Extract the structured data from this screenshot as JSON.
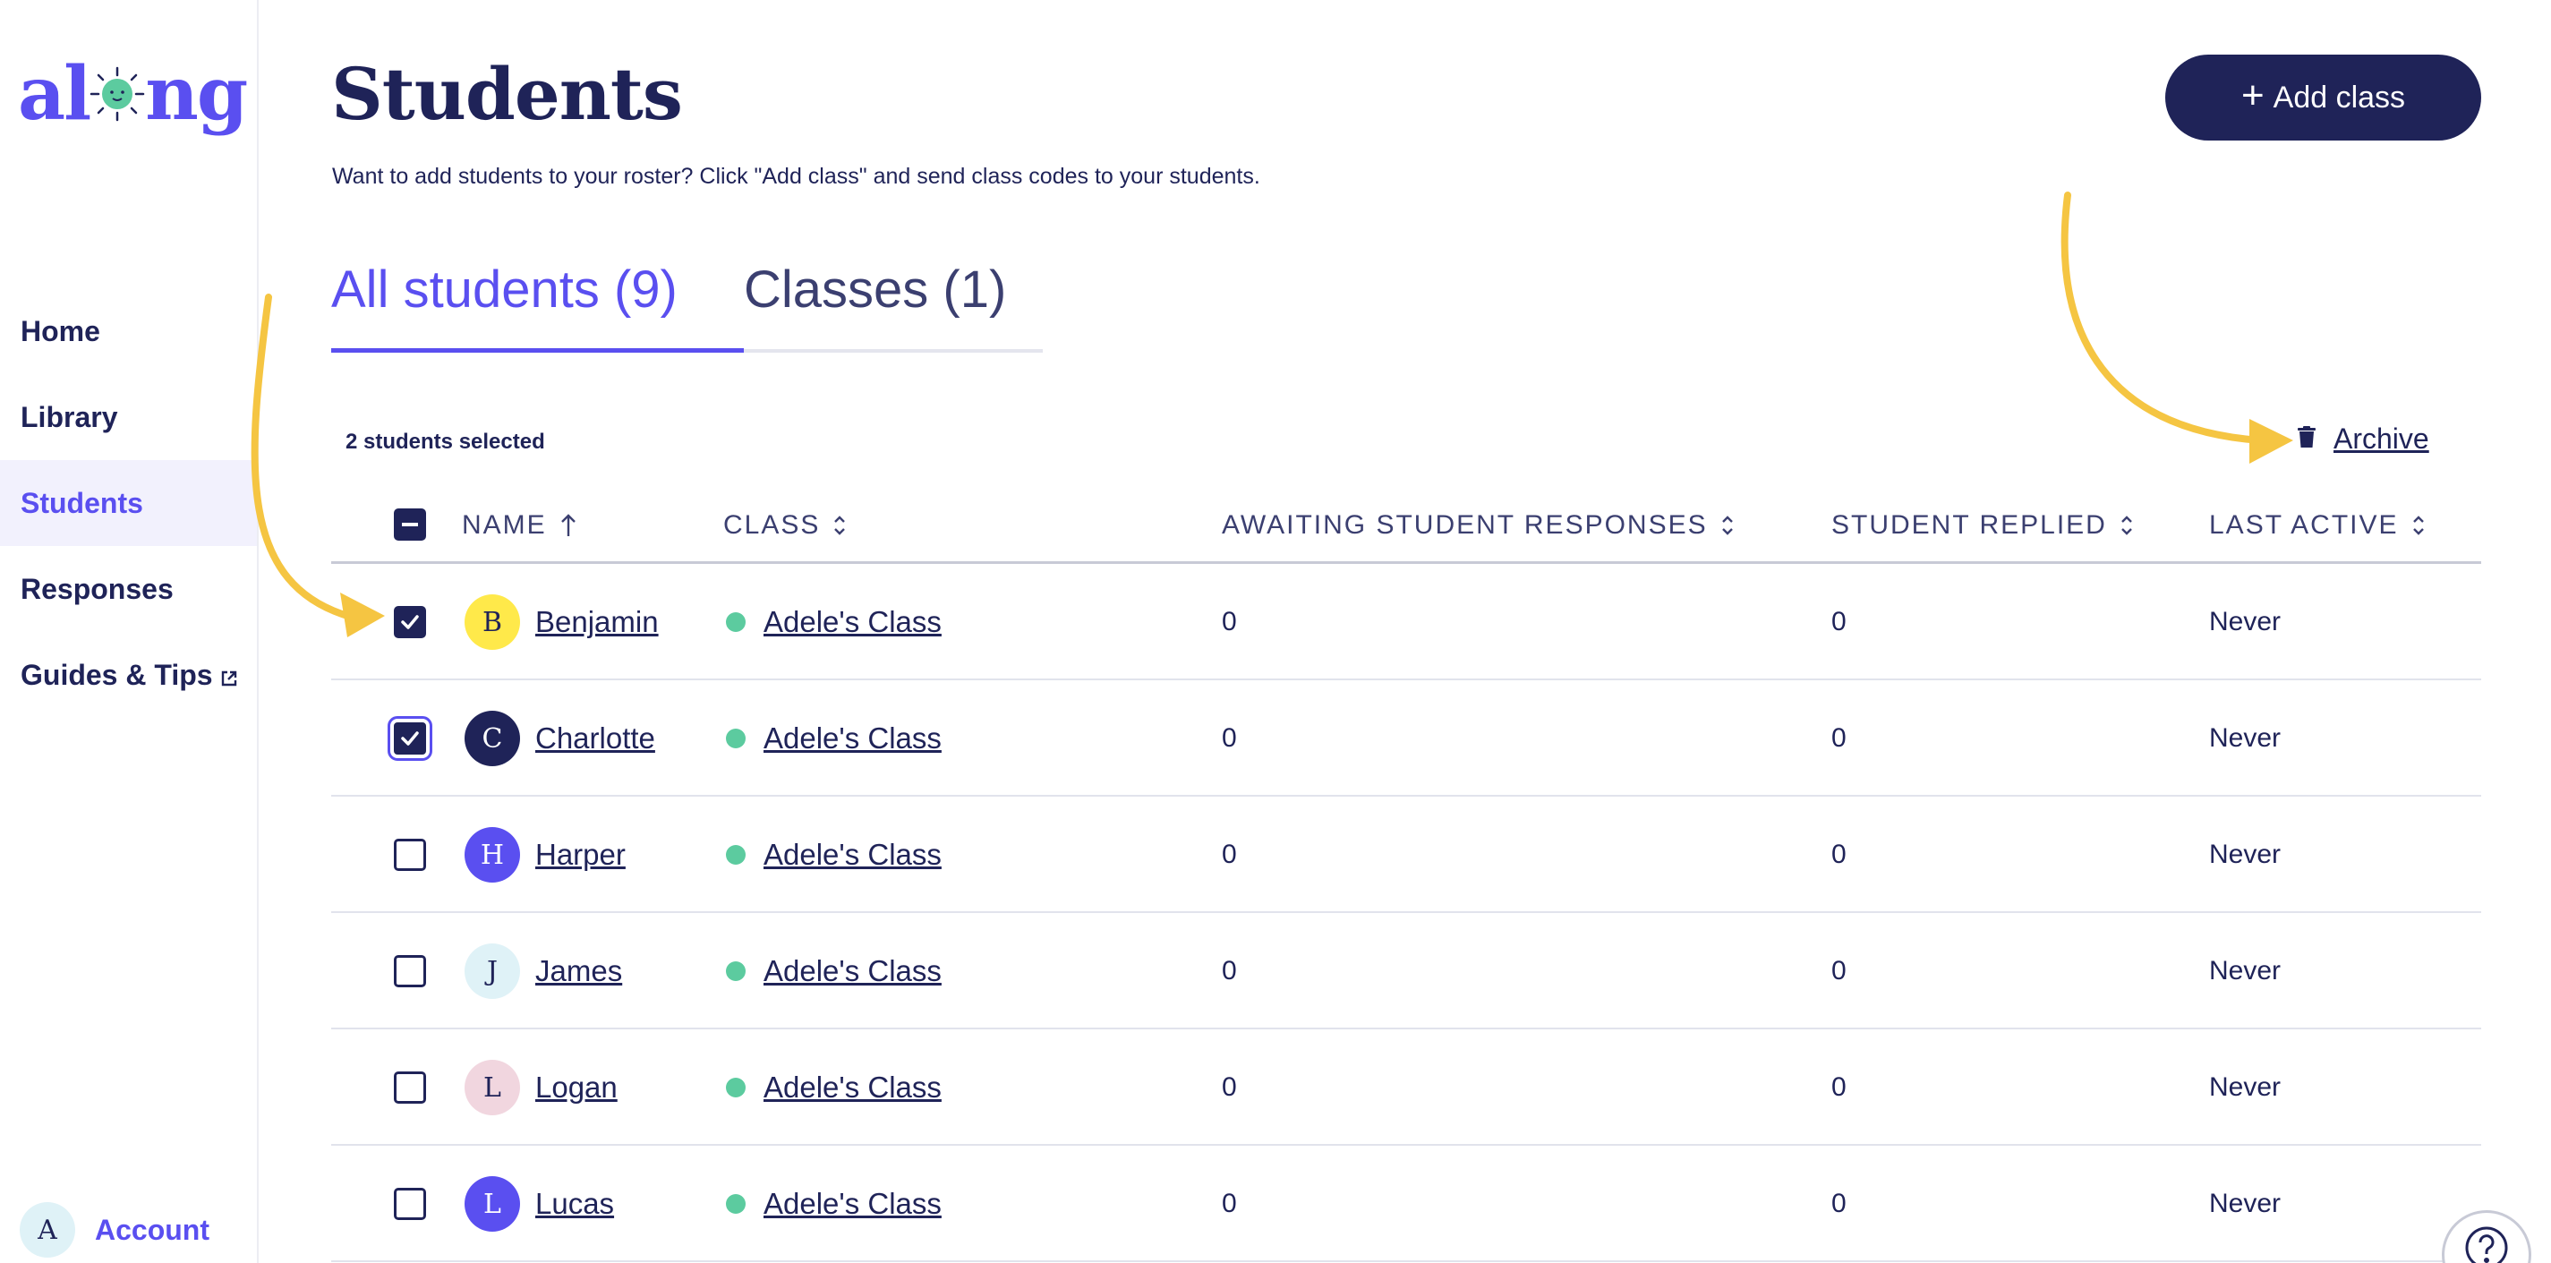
{
  "brand": {
    "logo_left": "al",
    "logo_right": "ng"
  },
  "sidebar": {
    "items": [
      {
        "label": "Home"
      },
      {
        "label": "Library"
      },
      {
        "label": "Students"
      },
      {
        "label": "Responses"
      },
      {
        "label": "Guides & Tips"
      }
    ],
    "account": {
      "initial": "A",
      "label": "Account"
    }
  },
  "header": {
    "title": "Students",
    "subtitle": "Want to add students to your roster? Click \"Add class\" and send class codes to your students.",
    "add_class_label": "Add class"
  },
  "tabs": [
    {
      "label": "All students (9)",
      "active": true
    },
    {
      "label": "Classes (1)",
      "active": false
    }
  ],
  "selection": {
    "label": "2 students selected"
  },
  "archive": {
    "label": "Archive"
  },
  "table": {
    "columns": {
      "name": "NAME",
      "class": "CLASS",
      "awaiting": "AWAITING STUDENT RESPONSES",
      "replied": "STUDENT REPLIED",
      "last_active": "LAST ACTIVE"
    },
    "rows": [
      {
        "initial": "B",
        "name": "Benjamin",
        "class": "Adele's Class",
        "awaiting": "0",
        "replied": "0",
        "last_active": "Never",
        "checked": true,
        "avatar_bg": "#ffe94a",
        "avatar_fg": "#1f2358"
      },
      {
        "initial": "C",
        "name": "Charlotte",
        "class": "Adele's Class",
        "awaiting": "0",
        "replied": "0",
        "last_active": "Never",
        "checked": true,
        "avatar_bg": "#1f2358",
        "avatar_fg": "#ffffff"
      },
      {
        "initial": "H",
        "name": "Harper",
        "class": "Adele's Class",
        "awaiting": "0",
        "replied": "0",
        "last_active": "Never",
        "checked": false,
        "avatar_bg": "#5a4ff0",
        "avatar_fg": "#ffffff"
      },
      {
        "initial": "J",
        "name": "James",
        "class": "Adele's Class",
        "awaiting": "0",
        "replied": "0",
        "last_active": "Never",
        "checked": false,
        "avatar_bg": "#dff2f7",
        "avatar_fg": "#1f2358"
      },
      {
        "initial": "L",
        "name": "Logan",
        "class": "Adele's Class",
        "awaiting": "0",
        "replied": "0",
        "last_active": "Never",
        "checked": false,
        "avatar_bg": "#f1d6df",
        "avatar_fg": "#1f2358"
      },
      {
        "initial": "L",
        "name": "Lucas",
        "class": "Adele's Class",
        "awaiting": "0",
        "replied": "0",
        "last_active": "Never",
        "checked": false,
        "avatar_bg": "#5a4ff0",
        "avatar_fg": "#ffffff"
      }
    ]
  },
  "colors": {
    "primary": "#1f2358",
    "accent": "#5a4ff0",
    "class_dot": "#5ccb9f",
    "annotation_arrow": "#f5c542"
  },
  "icons": {
    "archive": "trash-icon",
    "external": "external-link-icon",
    "help": "help-icon",
    "sort": "sort-icon"
  }
}
